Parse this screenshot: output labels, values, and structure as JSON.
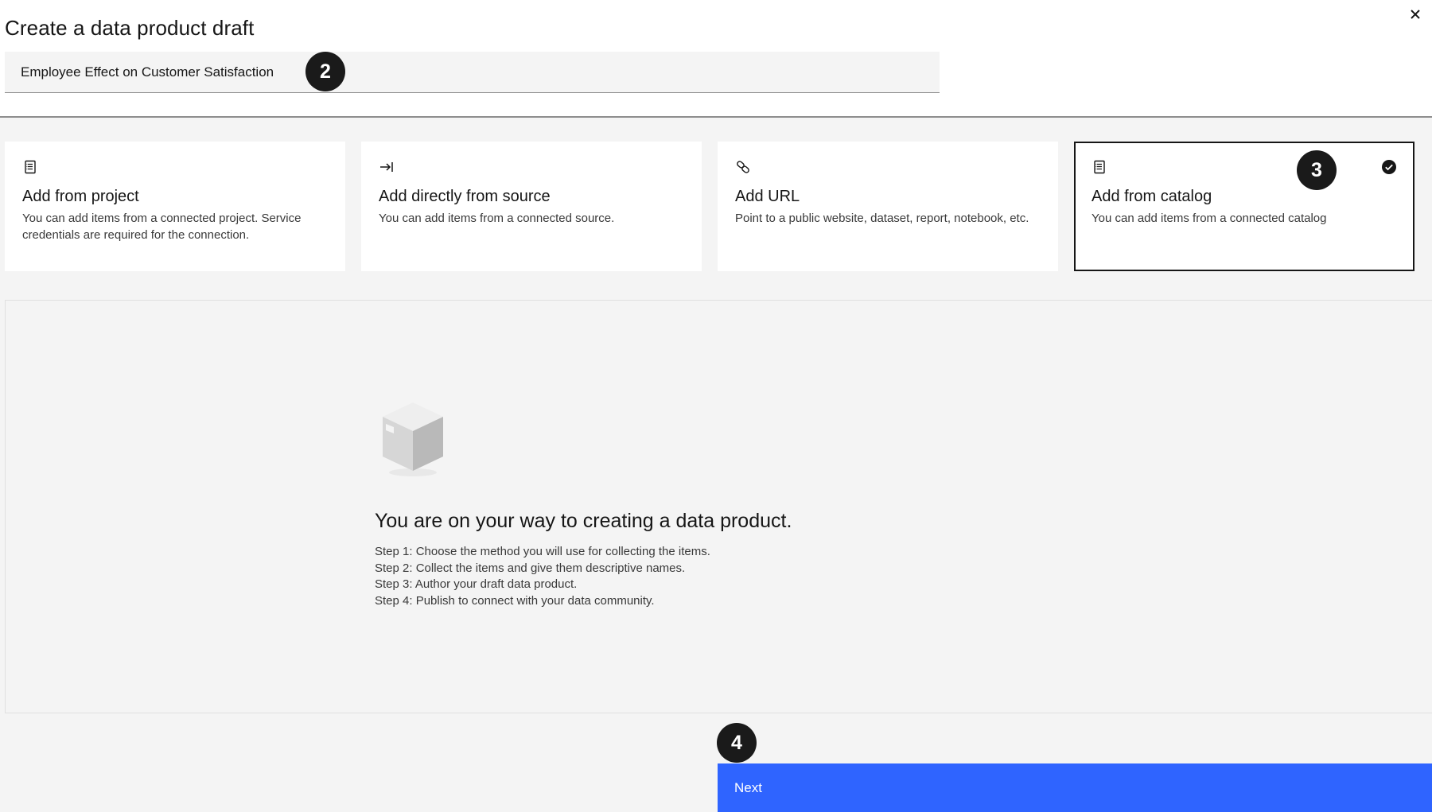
{
  "modal": {
    "title": "Create a data product draft",
    "close_label": "×"
  },
  "name_field": {
    "value": "Employee Effect on Customer Satisfaction"
  },
  "tiles": [
    {
      "icon": "document-list-icon",
      "title": "Add from project",
      "description": "You can add items from a connected project. Service credentials are required for the connection.",
      "selected": false
    },
    {
      "icon": "arrow-to-bar-icon",
      "title": "Add directly from source",
      "description": "You can add items from a connected source.",
      "selected": false
    },
    {
      "icon": "link-icon",
      "title": "Add URL",
      "description": "Point to a public website, dataset, report, notebook, etc.",
      "selected": false
    },
    {
      "icon": "document-list-icon",
      "title": "Add from catalog",
      "description": "You can add items from a connected catalog",
      "selected": true
    }
  ],
  "empty_state": {
    "icon": "box-icon",
    "title": "You are on your way to creating a data product.",
    "steps": [
      "Step 1: Choose the method you will use for collecting the items.",
      "Step 2: Collect the items and give them descriptive names.",
      "Step 3: Author your draft data product.",
      "Step 4: Publish to connect with your data community."
    ]
  },
  "footer": {
    "next_label": "Next"
  },
  "callouts": [
    "2",
    "3",
    "4"
  ],
  "colors": {
    "primary": "#2f64ff",
    "background": "#f4f4f4",
    "selected_border": "#161616",
    "callout": "#1a1a1a"
  }
}
